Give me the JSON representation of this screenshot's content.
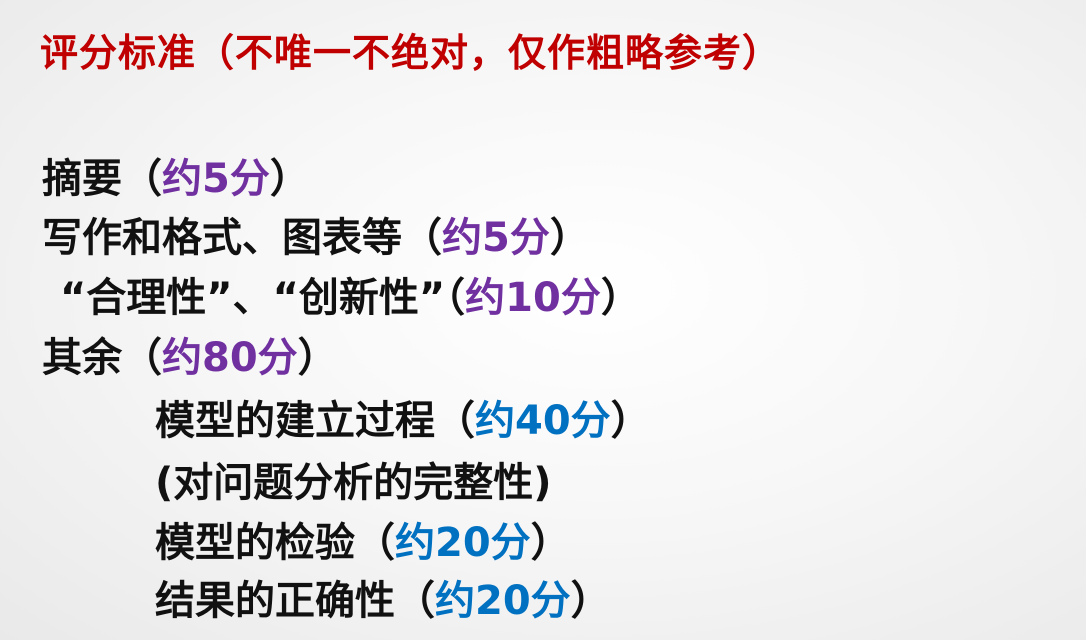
{
  "title": "评分标准（不唯一不绝对，仅作粗略参考）",
  "colors": {
    "title": "#c00000",
    "top_level_score": "#7030a0",
    "sub_level_score": "#0070c0",
    "text": "#111111"
  },
  "items": [
    {
      "pre": "摘要（",
      "score": "约5分",
      "post": "）"
    },
    {
      "pre": "写作和格式、图表等（",
      "score": "约5分",
      "post": "）"
    },
    {
      "pre": "“合理性”、“创新性”（",
      "score": "约10分",
      "post": "）"
    },
    {
      "pre": "其余（",
      "score": "约80分",
      "post": "）"
    }
  ],
  "sub_items": [
    {
      "pre": "模型的建立过程（",
      "score": "约40分",
      "post": "）"
    },
    {
      "text": "(对问题分析的完整性)"
    },
    {
      "pre": "模型的检验（",
      "score": "约20分",
      "post": "）"
    },
    {
      "pre": "结果的正确性（",
      "score": "约20分",
      "post": "）"
    }
  ]
}
